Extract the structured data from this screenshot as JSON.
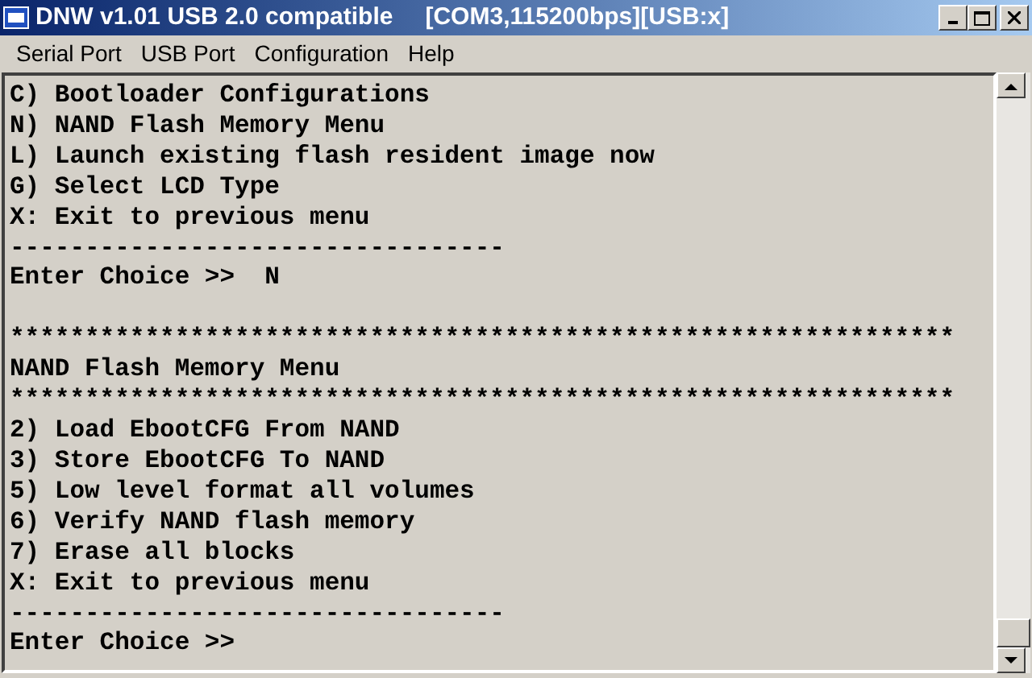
{
  "window": {
    "title": "DNW v1.01 USB 2.0 compatible",
    "status": "[COM3,115200bps][USB:x]"
  },
  "menu": [
    "Serial Port",
    "USB Port",
    "Configuration",
    "Help"
  ],
  "terminal": {
    "blocks": [
      [
        "C) Bootloader Configurations",
        "N) NAND Flash Memory Menu",
        "L) Launch existing flash resident image now",
        "G) Select LCD Type",
        "X: Exit to previous menu",
        "---------------------------------",
        "Enter Choice >>  N"
      ],
      [
        "***************************************************************",
        "NAND Flash Memory Menu",
        "***************************************************************",
        "2) Load EbootCFG From NAND",
        "3) Store EbootCFG To NAND",
        "5) Low level format all volumes",
        "6) Verify NAND flash memory",
        "7) Erase all blocks",
        "X: Exit to previous menu",
        "---------------------------------",
        "Enter Choice >>"
      ]
    ]
  }
}
